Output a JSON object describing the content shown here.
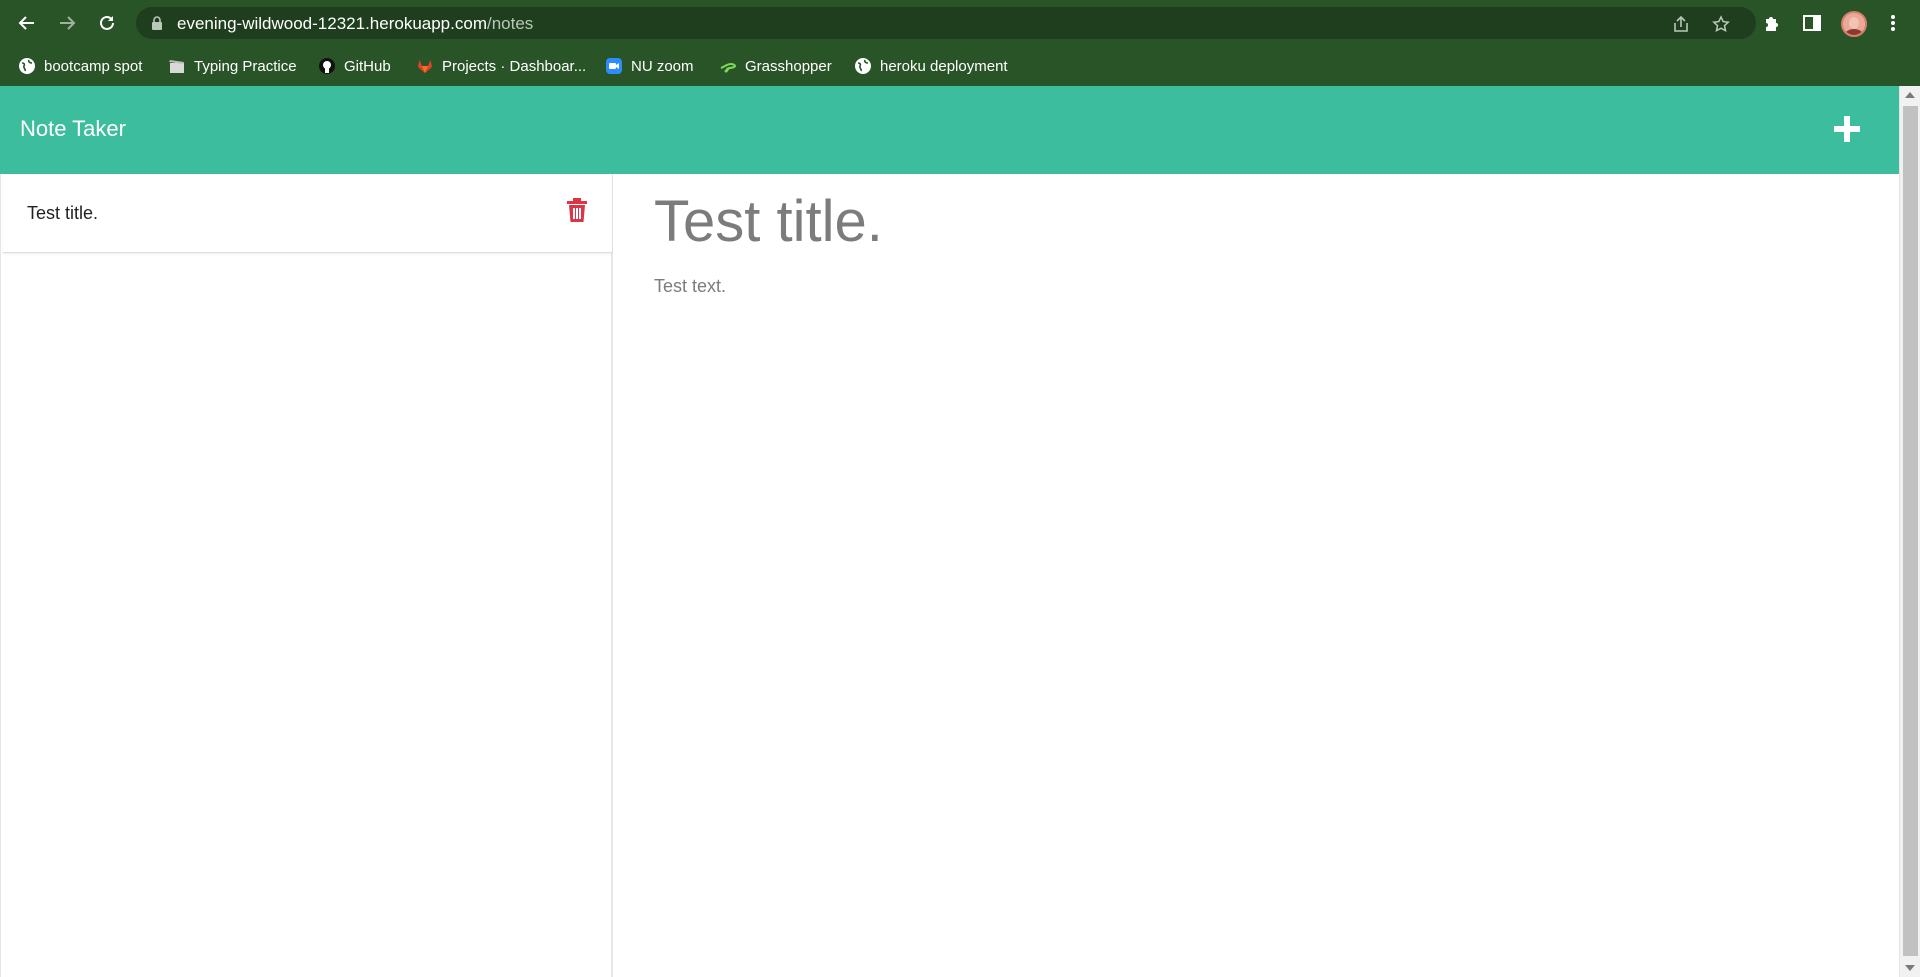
{
  "browser": {
    "url_host": "evening-wildwood-12321.herokuapp.com",
    "url_path": "/notes",
    "bookmarks": [
      {
        "label": "bootcamp spot",
        "icon": "globe-icon"
      },
      {
        "label": "Typing Practice",
        "icon": "clapperboard-icon"
      },
      {
        "label": "GitHub",
        "icon": "github-icon"
      },
      {
        "label": "Projects · Dashboar...",
        "icon": "gitlab-icon"
      },
      {
        "label": "NU zoom",
        "icon": "zoom-icon"
      },
      {
        "label": "Grasshopper",
        "icon": "grasshopper-icon"
      },
      {
        "label": "heroku deployment",
        "icon": "globe-icon"
      }
    ]
  },
  "app": {
    "brand": "Note Taker",
    "notes": [
      {
        "title": "Test title."
      }
    ],
    "active_note": {
      "title": "Test title.",
      "text": "Test text."
    }
  },
  "colors": {
    "chrome": "#295428",
    "navbar": "#3cbd9d",
    "delete": "#dc3545"
  }
}
